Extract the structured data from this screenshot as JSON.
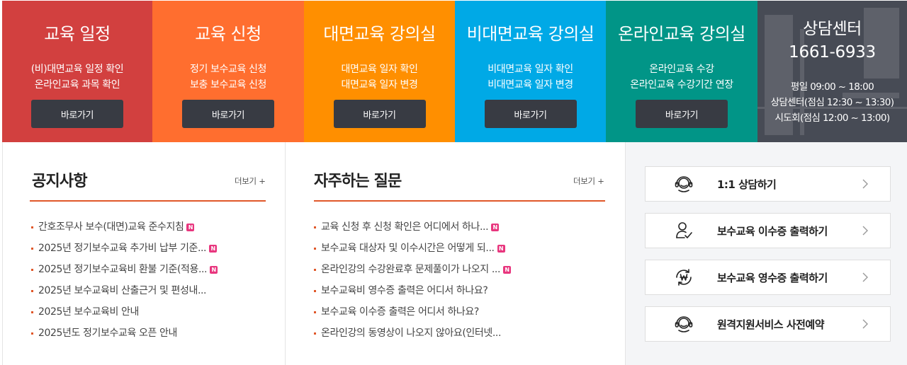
{
  "tiles": [
    {
      "title": "교육 일정",
      "lines": [
        "(비)대면교육 일정 확인",
        "온라인교육 과목 확인"
      ],
      "button": "바로가기"
    },
    {
      "title": "교육 신청",
      "lines": [
        "정기 보수교육 신청",
        "보충 보수교육 신청"
      ],
      "button": "바로가기"
    },
    {
      "title": "대면교육 강의실",
      "lines": [
        "대면교육 일자 확인",
        "대면교육 일자 변경"
      ],
      "button": "바로가기"
    },
    {
      "title": "비대면교육 강의실",
      "lines": [
        "비대면교육 일자 확인",
        "비대면교육 일자 변경"
      ],
      "button": "바로가기"
    },
    {
      "title": "온라인교육 강의실",
      "lines": [
        "온라인교육 수강",
        "온라인교육 수강기간 연장"
      ],
      "button": "바로가기"
    }
  ],
  "consult": {
    "title": "상담센터",
    "phone": "1661-6933",
    "hours": [
      "평일 09:00 ~ 18:00",
      "상담센터(점심 12:30 ~ 13:30)",
      "시도회(점심 12:00 ~ 13:00)"
    ]
  },
  "notice": {
    "title": "공지사항",
    "more": "더보기 +",
    "new_badge": "N",
    "items": [
      {
        "text": "간호조무사 보수(대면)교육 준수지침",
        "is_new": true
      },
      {
        "text": "2025년 정기보수교육 추가비 납부 기준...",
        "is_new": true
      },
      {
        "text": "2025년 정기보수교육비 환불 기준(적용...",
        "is_new": true
      },
      {
        "text": "2025년 보수교육비 산출근거 및 편성내...",
        "is_new": false
      },
      {
        "text": "2025년 보수교육비 안내",
        "is_new": false
      },
      {
        "text": "2025년도 정기보수교육 오픈 안내",
        "is_new": false
      }
    ]
  },
  "faq": {
    "title": "자주하는 질문",
    "more": "더보기 +",
    "new_badge": "N",
    "items": [
      {
        "text": "교육 신청 후 신청 확인은 어디에서 하나...",
        "is_new": true
      },
      {
        "text": "보수교육 대상자 및 이수시간은 어떻게 되...",
        "is_new": true
      },
      {
        "text": "온라인강의 수강완료후 문제풀이가 나오지 ...",
        "is_new": true
      },
      {
        "text": "보수교육비 영수증 출력은 어디서 하나요?",
        "is_new": false
      },
      {
        "text": "보수교육 이수증 출력은 어디서 하나요?",
        "is_new": false
      },
      {
        "text": "온라인강의 동영상이 나오지 않아요(인터넷...",
        "is_new": false
      }
    ]
  },
  "quick_links": [
    {
      "label": "1:1 상담하기",
      "icon": "headset-icon"
    },
    {
      "label": "보수교육 이수증 출력하기",
      "icon": "certificate-user-icon"
    },
    {
      "label": "보수교육 영수증 출력하기",
      "icon": "won-refresh-icon"
    },
    {
      "label": "원격지원서비스 사전예약",
      "icon": "headset-icon"
    }
  ],
  "colors": {
    "tile_schedule": "#d2403f",
    "tile_apply": "#ff6e2f",
    "tile_offline": "#ff8f00",
    "tile_remote": "#00a9e6",
    "tile_online": "#019587",
    "tile_consult": "#474b55",
    "accent_rule": "#e0582a",
    "button_dark": "#383b43",
    "new_badge": "#e8367e"
  }
}
